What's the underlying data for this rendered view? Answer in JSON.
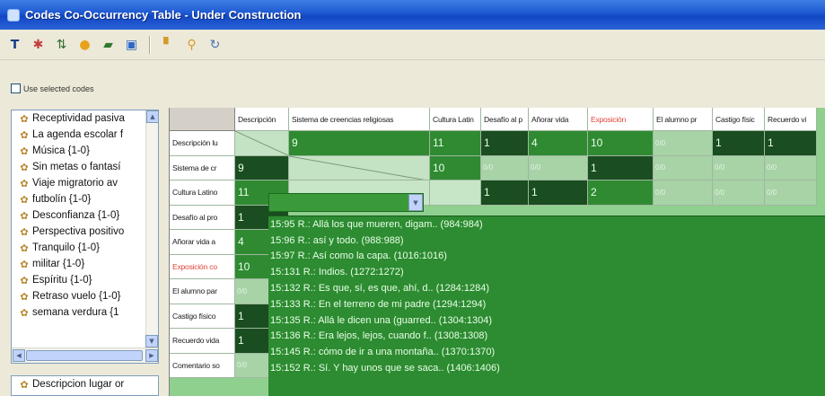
{
  "window": {
    "title": "Codes Co-Occurrency Table - Under Construction"
  },
  "toolbar": {
    "buttons": [
      {
        "name": "filter-icon",
        "glyph": "𝗧",
        "color": "#1b3f8a"
      },
      {
        "name": "snowflake-icon",
        "glyph": "✱",
        "color": "#c33d3d"
      },
      {
        "name": "sort-icon",
        "glyph": "⇅",
        "color": "#2f6e2f"
      },
      {
        "name": "color-palette-icon",
        "glyph": "●",
        "color": "#e8a21a"
      },
      {
        "name": "highlight-icon",
        "glyph": "▰",
        "color": "#2f7a2f"
      },
      {
        "name": "export-icon",
        "glyph": "▣",
        "color": "#2d66c6"
      },
      {
        "name": "pin-icon",
        "glyph": "▘",
        "color": "#d69a2a"
      },
      {
        "name": "code-icon",
        "glyph": "⚲",
        "color": "#d69a2a"
      },
      {
        "name": "refresh-icon",
        "glyph": "↻",
        "color": "#4f73b8"
      }
    ]
  },
  "options": {
    "use_selected_codes": "Use selected codes"
  },
  "codes_list": [
    "Receptividad pasiva",
    "La agenda escolar f",
    "Música {1-0}",
    "Sin metas o fantasí",
    "Viaje migratorio av",
    "futbolín {1-0}",
    "Desconfianza {1-0}",
    "Perspectiva positivo",
    "Tranquilo {1-0}",
    "militar {1-0}",
    "Espíritu {1-0}",
    "Retraso vuelo {1-0}",
    "semana verdura {1"
  ],
  "codes_list_2": [
    "Descripcion lugar or"
  ],
  "table": {
    "columns": [
      {
        "label": "Descripción",
        "red": false
      },
      {
        "label": "Sistema de creencias religiosas",
        "red": false
      },
      {
        "label": "Cultura Latin",
        "red": false
      },
      {
        "label": "Desafío al p",
        "red": false
      },
      {
        "label": "Añorar vida",
        "red": false
      },
      {
        "label": "Exposición",
        "red": true
      },
      {
        "label": "El alumno pr",
        "red": false
      },
      {
        "label": "Castigo físic",
        "red": false
      },
      {
        "label": "Recuerdo vi",
        "red": false
      }
    ],
    "rows": [
      {
        "label": "Descripción lu",
        "red": false,
        "cells": [
          "diag",
          "9",
          "11",
          "1",
          "4",
          "10",
          "",
          "1",
          "1"
        ],
        "styles": [
          "diag",
          "mid",
          "mid",
          "dark",
          "mid",
          "mid",
          "light",
          "dark",
          "dark"
        ]
      },
      {
        "label": "Sistema de cr",
        "red": false,
        "cells": [
          "9",
          "diag",
          "10",
          "",
          "",
          "1",
          "",
          "",
          ""
        ],
        "styles": [
          "dark",
          "diag",
          "mid",
          "light",
          "light",
          "dark",
          "light",
          "light",
          "light"
        ]
      },
      {
        "label": "Cultura Latino",
        "red": false,
        "cells": [
          "11",
          "",
          "",
          "1",
          "1",
          "2",
          "",
          "",
          ""
        ],
        "styles": [
          "mid",
          "combo",
          "empty",
          "dark",
          "dark",
          "mid",
          "light",
          "light",
          "light"
        ]
      },
      {
        "label": "Desafío al pro",
        "red": false,
        "cells": [
          "1"
        ],
        "styles": [
          "dark"
        ]
      },
      {
        "label": "Añorar vida a",
        "red": false,
        "cells": [
          "4"
        ],
        "styles": [
          "mid"
        ]
      },
      {
        "label": "Exposición co",
        "red": true,
        "cells": [
          "10"
        ],
        "styles": [
          "mid"
        ]
      },
      {
        "label": "El alumno par",
        "red": false,
        "cells": [
          ""
        ],
        "styles": [
          "light"
        ]
      },
      {
        "label": "Castigo físico",
        "red": false,
        "cells": [
          "1"
        ],
        "styles": [
          "dark"
        ]
      },
      {
        "label": "Recuerdo vida",
        "red": false,
        "cells": [
          "1"
        ],
        "styles": [
          "dark"
        ]
      },
      {
        "label": "Comentario so",
        "red": false,
        "cells": [
          ""
        ],
        "styles": [
          "light"
        ]
      }
    ],
    "light_cell_text": "0/0"
  },
  "quotes": [
    "15:95 R.: Allá los que mueren, digam.. (984:984)",
    "15:96 R.: así y todo. (988:988)",
    "15:97 R.: Así como la capa. (1016:1016)",
    "15:131 R.: Indios. (1272:1272)",
    "15:132 R.: Es que, sí, es que, ahí, d.. (1284:1284)",
    "15:133 R.: En el terreno de mi padre (1294:1294)",
    "15:135 R.: Allá le dicen una (guarred.. (1304:1304)",
    "15:136 R.: Era lejos, lejos, cuando f.. (1308:1308)",
    "15:145 R.: cómo de ir a una montaña.. (1370:1370)",
    "15:152 R.: Sí. Y hay unos que se saca.. (1406:1406)"
  ],
  "colors": {
    "title_bar": "#1c57d1",
    "cell_mid": "#2f8a32",
    "cell_dark": "#1a4d20",
    "cell_light": "#a7d3a7",
    "highlight_red": "#e0443a"
  }
}
